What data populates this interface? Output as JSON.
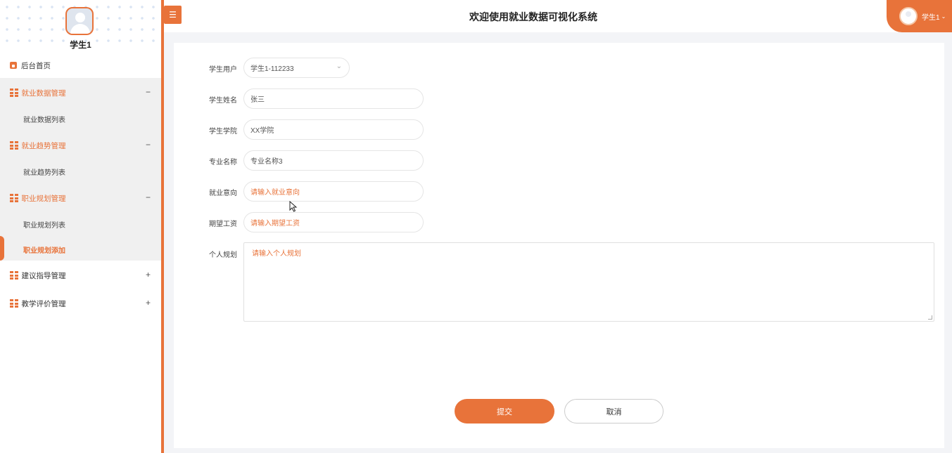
{
  "sidebar": {
    "username": "学生1",
    "home": "后台首页",
    "groups": [
      {
        "label": "就业数据管理",
        "toggle": "−",
        "sub": "就业数据列表"
      },
      {
        "label": "就业趋势管理",
        "toggle": "−",
        "sub": "就业趋势列表"
      },
      {
        "label": "职业规划管理",
        "toggle": "−",
        "sub": "职业规划列表",
        "sub2": "职业规划添加"
      },
      {
        "label": "建议指导管理",
        "toggle": "+"
      },
      {
        "label": "教学评价管理",
        "toggle": "+"
      }
    ]
  },
  "header": {
    "menu_icon": "☰",
    "title": "欢迎使用就业数据可视化系统",
    "user": "学生1",
    "caret": "⌄"
  },
  "form": {
    "fields": [
      {
        "label": "学生用户",
        "value": "学生1-112233",
        "arrow": "⌄"
      },
      {
        "label": "学生姓名",
        "value": "张三"
      },
      {
        "label": "学生学院",
        "value": "XX学院"
      },
      {
        "label": "专业名称",
        "value": "专业名称3"
      },
      {
        "label": "就业意向",
        "placeholder": "请输入就业意向"
      },
      {
        "label": "期望工资",
        "placeholder": "请输入期望工资"
      },
      {
        "label": "个人规划",
        "placeholder": "请输入个人规划"
      }
    ],
    "submit": "提交",
    "cancel": "取消"
  },
  "colors": {
    "accent": "#e8733a"
  }
}
